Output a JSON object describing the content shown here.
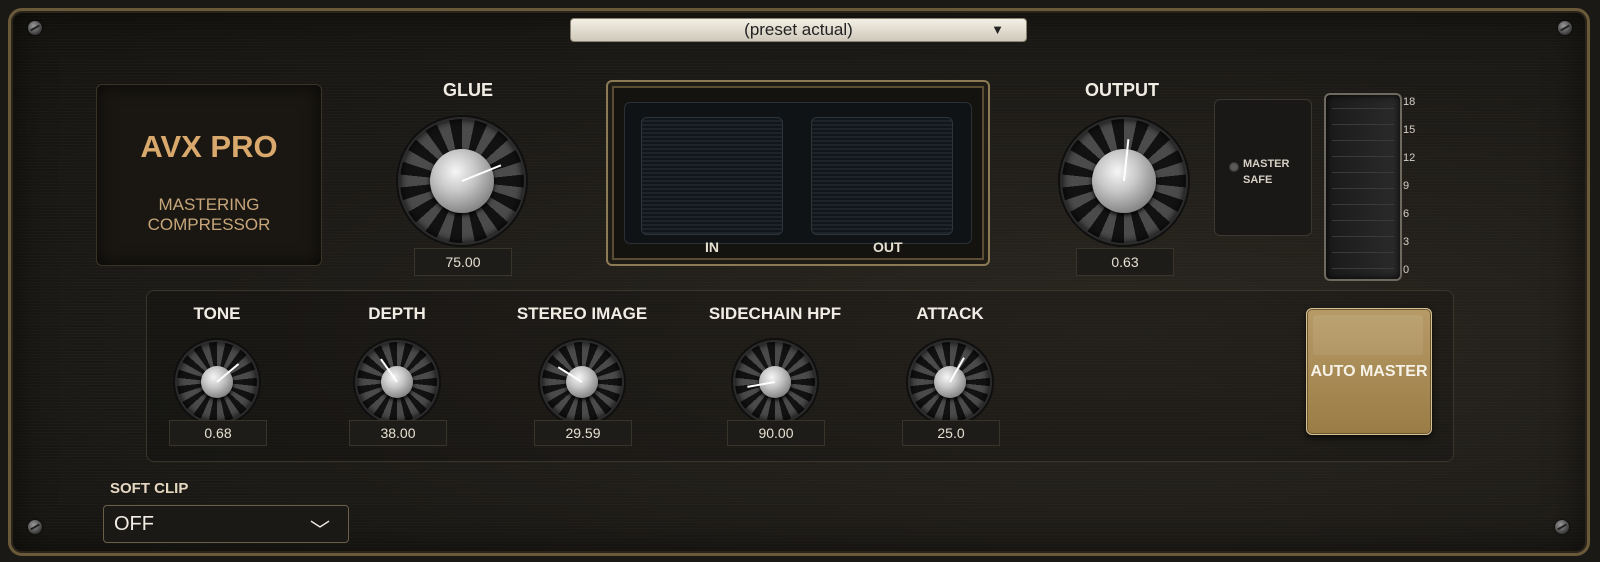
{
  "preset": {
    "label": "(preset actual)",
    "arrow": "▼"
  },
  "brand": {
    "title": "AVX PRO",
    "subtitle": "MASTERING COMPRESSOR"
  },
  "glue": {
    "label": "GLUE",
    "value": "75.00"
  },
  "meter": {
    "in_label": "IN",
    "out_label": "OUT"
  },
  "output": {
    "label": "OUTPUT",
    "value": "0.63"
  },
  "master_safe": {
    "line1": "MASTER",
    "line2": "SAFE"
  },
  "fader_scale": [
    "18",
    "15",
    "12",
    "9",
    "6",
    "3",
    "0"
  ],
  "knobs": [
    {
      "label": "TONE",
      "value": "0.68"
    },
    {
      "label": "DEPTH",
      "value": "38.00"
    },
    {
      "label": "STEREO IMAGE",
      "value": "29.59"
    },
    {
      "label": "SIDECHAIN HPF",
      "value": "90.00"
    },
    {
      "label": "ATTACK",
      "value": "25.0"
    }
  ],
  "auto_master": {
    "label": "AUTO MASTER"
  },
  "soft_clip": {
    "label": "SOFT CLIP",
    "value": "OFF",
    "chevron": "﹀"
  },
  "colors": {
    "accent_gold": "#d9a86c",
    "button_gold": "#b79b67",
    "text_light": "#f2ede4"
  }
}
